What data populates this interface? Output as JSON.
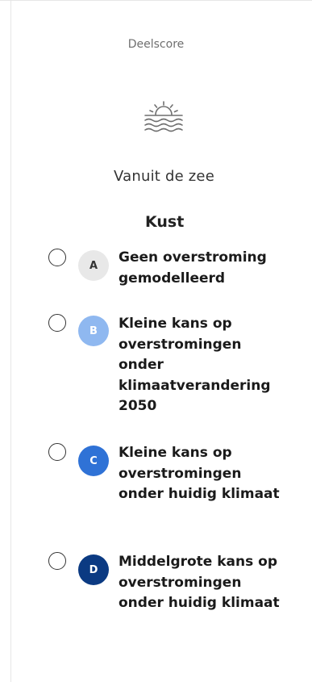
{
  "panel": {
    "score_label": "Deelscore",
    "hazard_icon": "sun-over-sea-icon",
    "category_title": "Vanuit de zee",
    "section_title": "Kust"
  },
  "legend": {
    "items": [
      {
        "letter": "A",
        "label": "Geen overstroming gemodelleerd",
        "badge_color": "#e8e8e8",
        "letter_color": "#333333"
      },
      {
        "letter": "B",
        "label": "Kleine kans op overstromingen onder klimaatverandering 2050",
        "badge_color": "#8fb8f0",
        "letter_color": "#ffffff"
      },
      {
        "letter": "C",
        "label": "Kleine kans op overstromingen onder huidig klimaat",
        "badge_color": "#2f72d6",
        "letter_color": "#ffffff"
      },
      {
        "letter": "D",
        "label": "Middelgrote kans op overstromingen onder huidig klimaat",
        "badge_color": "#0b3a82",
        "letter_color": "#ffffff"
      }
    ]
  }
}
